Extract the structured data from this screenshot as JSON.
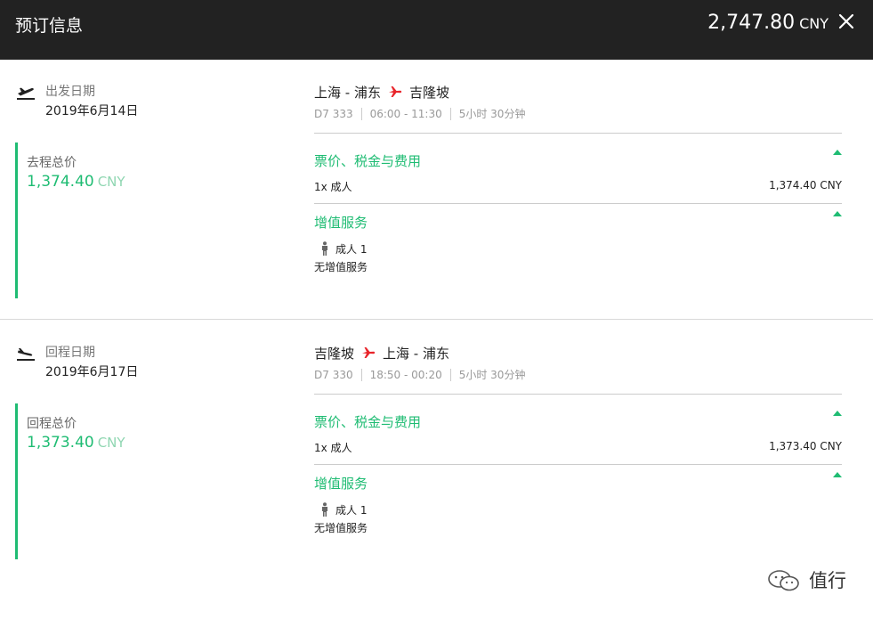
{
  "header": {
    "title": "预订信息",
    "total_amount": "2,747.80",
    "total_currency": "CNY",
    "close_icon": "close-icon"
  },
  "outbound": {
    "date_label": "出发日期",
    "date_value": "2019年6月14日",
    "price_label": "去程总价",
    "price_amount": "1,374.40",
    "price_currency": "CNY",
    "origin": "上海 - 浦东",
    "destination": "吉隆坡",
    "flight_no": "D7 333",
    "time": "06:00 - 11:30",
    "duration": "5小时 30分钟",
    "fees_title": "票价、税金与费用",
    "fees_item_label": "1x 成人",
    "fees_item_amount": "1,374.40 CNY",
    "services_title": "增值服务",
    "passenger": "成人 1",
    "no_service": "无增值服务"
  },
  "inbound": {
    "date_label": "回程日期",
    "date_value": "2019年6月17日",
    "price_label": "回程总价",
    "price_amount": "1,373.40",
    "price_currency": "CNY",
    "origin": "吉隆坡",
    "destination": "上海 - 浦东",
    "flight_no": "D7 330",
    "time": "18:50 - 00:20",
    "duration": "5小时 30分钟",
    "fees_title": "票价、税金与费用",
    "fees_item_label": "1x 成人",
    "fees_item_amount": "1,373.40 CNY",
    "services_title": "增值服务",
    "passenger": "成人 1",
    "no_service": "无增值服务"
  },
  "watermark": {
    "text": "值行"
  },
  "colors": {
    "accent_green": "#1fbc73",
    "header_bg": "#222222",
    "plane_red": "#e8252b"
  }
}
